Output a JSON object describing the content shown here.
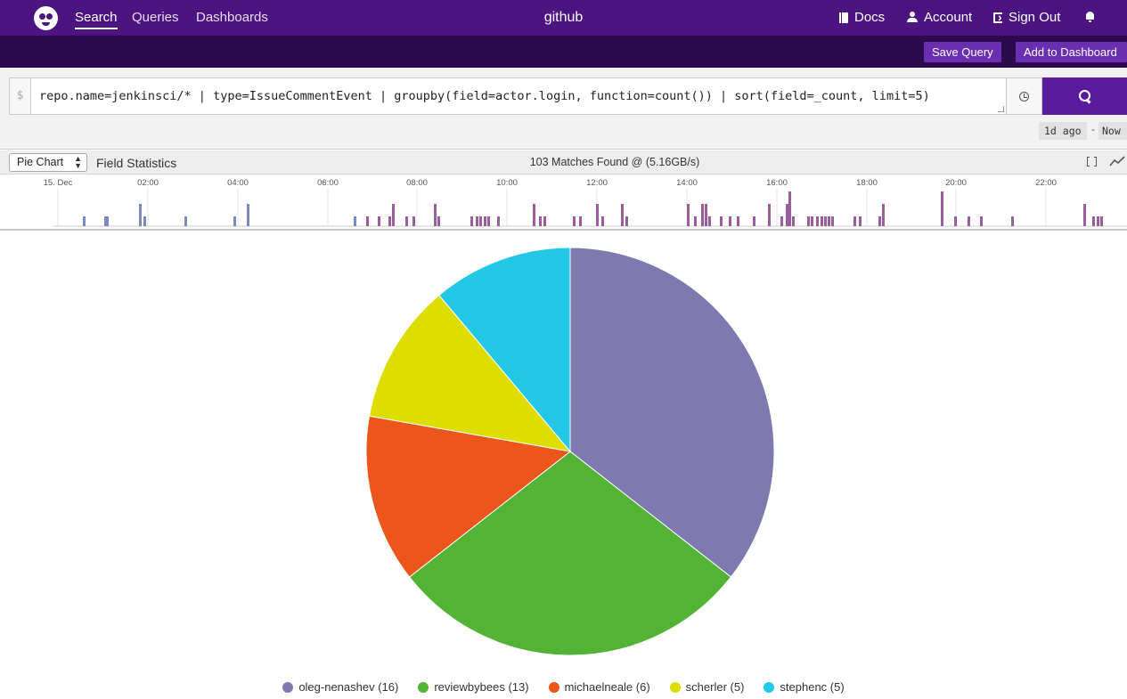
{
  "nav": {
    "search": "Search",
    "queries": "Queries",
    "dashboards": "Dashboards",
    "repo": "github",
    "docs": "Docs",
    "account": "Account",
    "sign_out": "Sign Out"
  },
  "toolbar": {
    "save_query": "Save Query",
    "add_to_dashboard": "Add to Dashboard"
  },
  "query": {
    "prompt": "$",
    "text": "repo.name=jenkinsci/* | type=IssueCommentEvent | groupby(field=actor.login, function=count()) | sort(field=_count, limit=5)",
    "time_start": "1d ago",
    "time_sep": "-",
    "time_end": "Now"
  },
  "controls": {
    "visualization": "Pie Chart",
    "field_statistics": "Field Statistics",
    "matches": "103 Matches Found @ (5.16GB/s)"
  },
  "histogram": {
    "tick_labels": [
      "15. Dec",
      "02:00",
      "04:00",
      "06:00",
      "08:00",
      "10:00",
      "12:00",
      "14:00",
      "16:00",
      "18:00",
      "20:00",
      "22:00"
    ],
    "color_early": "#8089bb",
    "color_late": "#9a5e9c"
  },
  "chart_data": {
    "type": "pie",
    "categories": [
      "oleg-nenashev",
      "reviewbybees",
      "michaelneale",
      "scherler",
      "stephenc"
    ],
    "values": [
      16,
      13,
      6,
      5,
      5
    ],
    "colors": [
      "#7e7ab0",
      "#52b335",
      "#ec561a",
      "#dddd00",
      "#24c8e6"
    ],
    "legend": [
      "oleg-nenashev (16)",
      "reviewbybees (13)",
      "michaelneale (6)",
      "scherler (5)",
      "stephenc (5)"
    ],
    "legend_position": "bottom"
  }
}
